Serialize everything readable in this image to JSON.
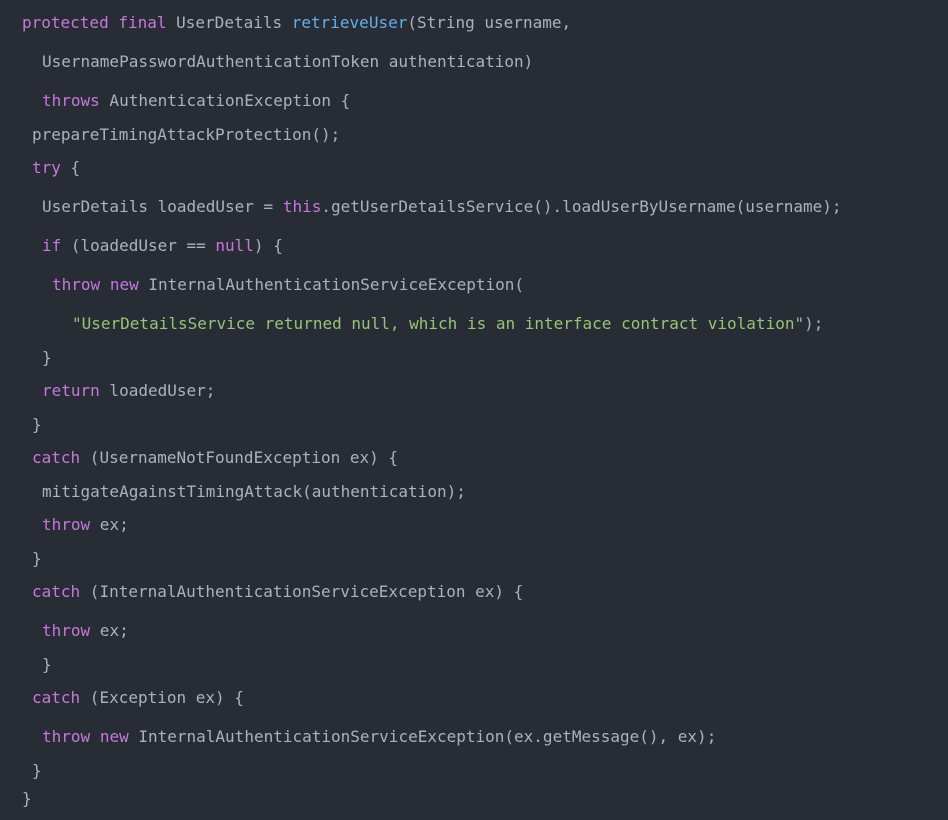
{
  "code": {
    "lines": [
      [
        {
          "t": "kw",
          "v": "protected"
        },
        {
          "t": "plain",
          "v": " "
        },
        {
          "t": "kw",
          "v": "final"
        },
        {
          "t": "plain",
          "v": " UserDetails "
        },
        {
          "t": "fn",
          "v": "retrieveUser"
        },
        {
          "t": "plain",
          "v": "(String username,"
        }
      ],
      [
        {
          "t": "plain",
          "v": "UsernamePasswordAuthenticationToken authentication)"
        }
      ],
      [
        {
          "t": "kw",
          "v": "throws"
        },
        {
          "t": "plain",
          "v": " AuthenticationException {"
        }
      ],
      [
        {
          "t": "plain",
          "v": "prepareTimingAttackProtection();"
        }
      ],
      [
        {
          "t": "kw",
          "v": "try"
        },
        {
          "t": "plain",
          "v": " {"
        }
      ],
      [
        {
          "t": "plain",
          "v": "UserDetails loadedUser = "
        },
        {
          "t": "kw",
          "v": "this"
        },
        {
          "t": "plain",
          "v": ".getUserDetailsService().loadUserByUsername(username);"
        }
      ],
      [
        {
          "t": "kw",
          "v": "if"
        },
        {
          "t": "plain",
          "v": " (loadedUser == "
        },
        {
          "t": "kw",
          "v": "null"
        },
        {
          "t": "plain",
          "v": ") {"
        }
      ],
      [
        {
          "t": "kw",
          "v": "throw"
        },
        {
          "t": "plain",
          "v": " "
        },
        {
          "t": "kw",
          "v": "new"
        },
        {
          "t": "plain",
          "v": " InternalAuthenticationServiceException("
        }
      ],
      [
        {
          "t": "str",
          "v": "\"UserDetailsService returned null, which is an interface contract violation\""
        },
        {
          "t": "plain",
          "v": ");"
        }
      ],
      [
        {
          "t": "plain",
          "v": "}"
        }
      ],
      [
        {
          "t": "kw",
          "v": "return"
        },
        {
          "t": "plain",
          "v": " loadedUser;"
        }
      ],
      [
        {
          "t": "plain",
          "v": "}"
        }
      ],
      [
        {
          "t": "kw",
          "v": "catch"
        },
        {
          "t": "plain",
          "v": " (UsernameNotFoundException ex) {"
        }
      ],
      [
        {
          "t": "plain",
          "v": "mitigateAgainstTimingAttack(authentication);"
        }
      ],
      [
        {
          "t": "kw",
          "v": "throw"
        },
        {
          "t": "plain",
          "v": " ex;"
        }
      ],
      [
        {
          "t": "plain",
          "v": "}"
        }
      ],
      [
        {
          "t": "kw",
          "v": "catch"
        },
        {
          "t": "plain",
          "v": " (InternalAuthenticationServiceException ex) {"
        }
      ],
      [
        {
          "t": "kw",
          "v": "throw"
        },
        {
          "t": "plain",
          "v": " ex;"
        }
      ],
      [
        {
          "t": "plain",
          "v": "}"
        }
      ],
      [
        {
          "t": "kw",
          "v": "catch"
        },
        {
          "t": "plain",
          "v": " (Exception ex) {"
        }
      ],
      [
        {
          "t": "kw",
          "v": "throw"
        },
        {
          "t": "plain",
          "v": " "
        },
        {
          "t": "kw",
          "v": "new"
        },
        {
          "t": "plain",
          "v": " InternalAuthenticationServiceException(ex.getMessage(), ex);"
        }
      ],
      [
        {
          "t": "plain",
          "v": "}"
        }
      ],
      [
        {
          "t": "plain",
          "v": "}"
        }
      ]
    ]
  }
}
